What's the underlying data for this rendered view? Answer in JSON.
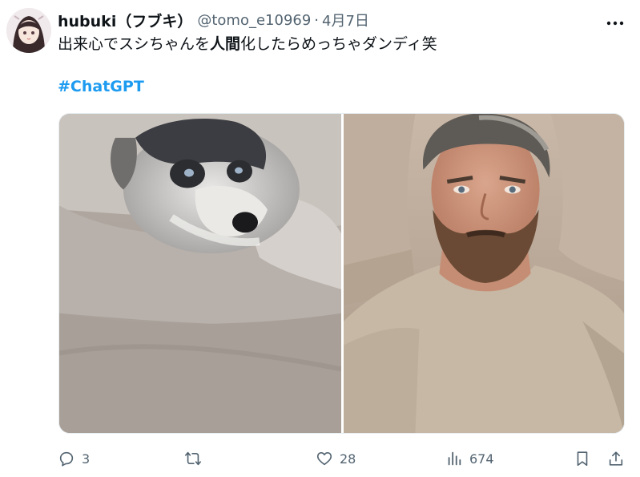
{
  "author": {
    "display_name": "hubuki（フブキ）",
    "handle": "@tomo_e10969",
    "separator": "·",
    "date": "4月7日"
  },
  "tweet": {
    "text_before": "出来心でスシちゃんを",
    "text_bold": "人間",
    "text_after": "化したらめっちゃダンディ笑",
    "hashtag": "#ChatGPT"
  },
  "actions": {
    "reply_count": "3",
    "retweet_count": "",
    "like_count": "28",
    "view_count": "674"
  },
  "icons": {
    "more": "more-icon",
    "reply": "reply-icon",
    "retweet": "retweet-icon",
    "like": "heart-icon",
    "views": "views-icon",
    "bookmark": "bookmark-icon",
    "share": "share-icon"
  },
  "colors": {
    "text": "#0f1419",
    "secondary": "#536471",
    "link": "#1d9bf0"
  }
}
